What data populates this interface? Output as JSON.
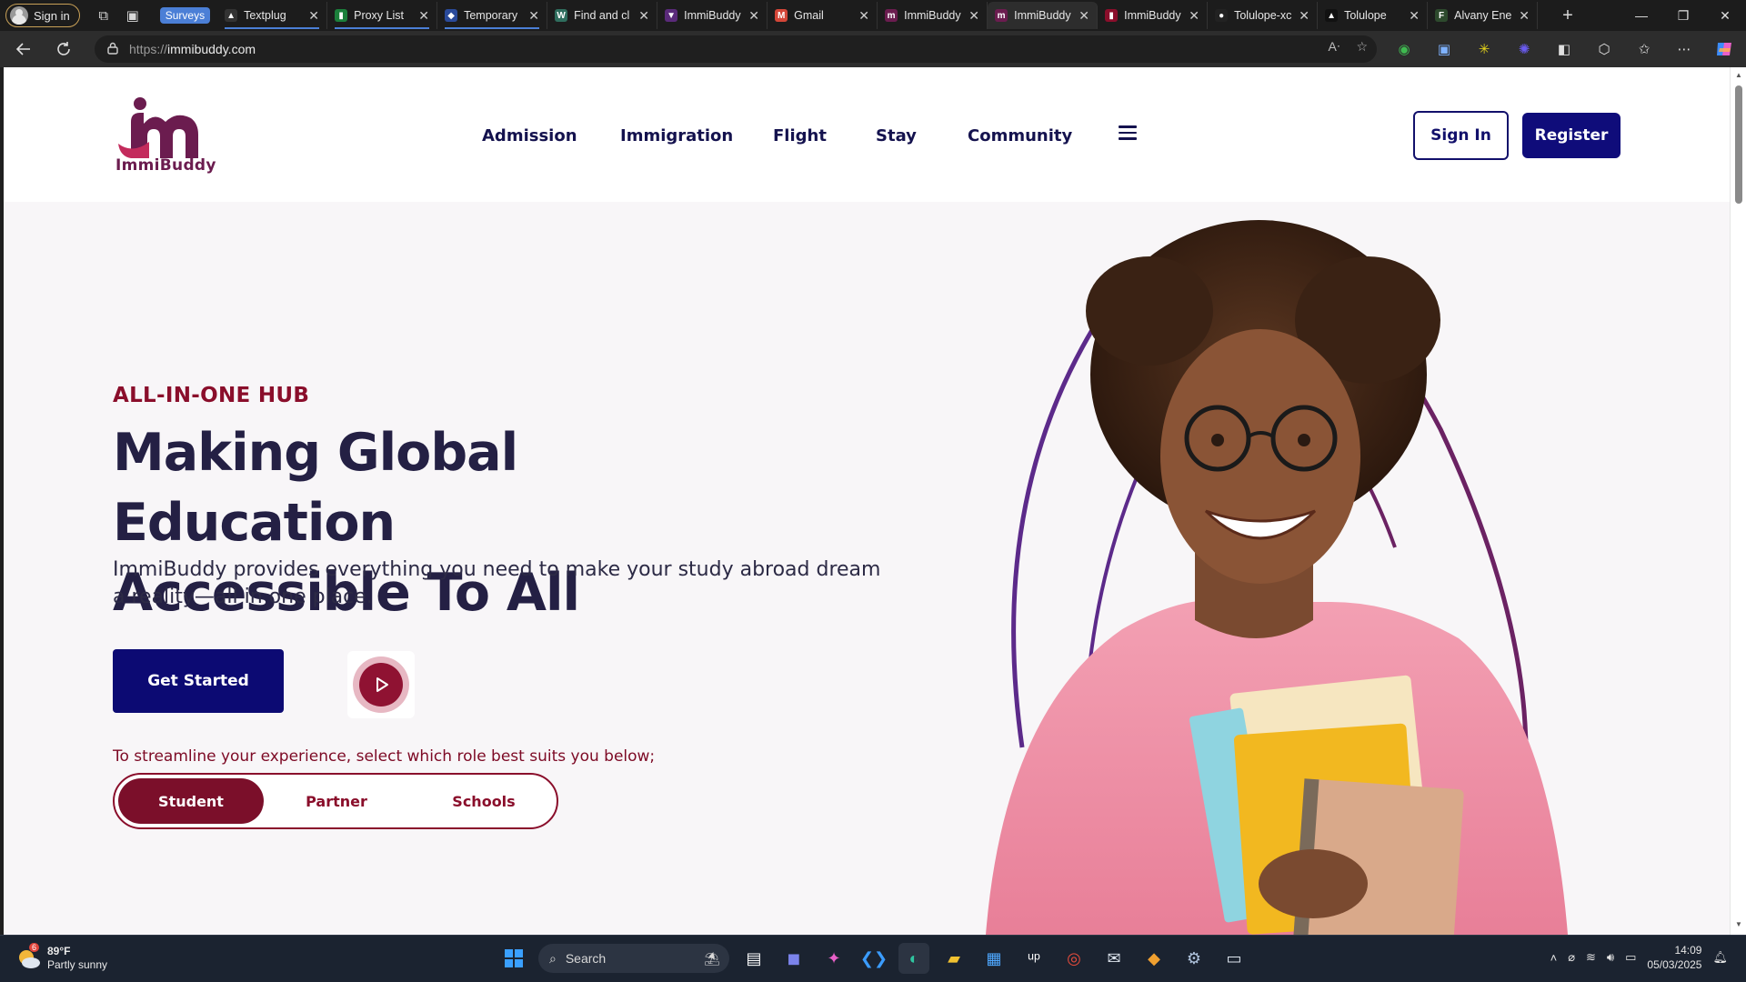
{
  "browser": {
    "profile_label": "Sign in",
    "tab_group_label": "Surveys",
    "tabs": [
      {
        "title": "Textplug",
        "favicon_color": "#333333",
        "favicon_char": "▲"
      },
      {
        "title": "Proxy List",
        "favicon_color": "#1b7f3b",
        "favicon_char": "▮"
      },
      {
        "title": "Temporary",
        "favicon_color": "#2a4a9a",
        "favicon_char": "◆"
      },
      {
        "title": "Find and cl",
        "favicon_color": "#2f6e5e",
        "favicon_char": "W"
      },
      {
        "title": "ImmiBuddy",
        "favicon_color": "#5a2a7a",
        "favicon_char": "▼"
      },
      {
        "title": "Gmail",
        "favicon_color": "#d44638",
        "favicon_char": "M"
      },
      {
        "title": "ImmiBuddy",
        "favicon_color": "#6b1c4f",
        "favicon_char": "m"
      },
      {
        "title": "ImmiBuddy",
        "favicon_color": "#6b1c4f",
        "favicon_char": "m"
      },
      {
        "title": "ImmiBuddy",
        "favicon_color": "#8a0e2b",
        "favicon_char": "▮"
      },
      {
        "title": "Tolulope-xc",
        "favicon_color": "#222222",
        "favicon_char": "●"
      },
      {
        "title": "Tolulope",
        "favicon_color": "#111111",
        "favicon_char": "▲"
      },
      {
        "title": "Alvany Ene",
        "favicon_color": "#2d4a2d",
        "favicon_char": "F"
      }
    ],
    "active_tab_index": 7,
    "url_scheme": "https://",
    "url_host": "immibuddy.com"
  },
  "site": {
    "logo_text": "ImmiBuddy",
    "nav": [
      "Admission",
      "Immigration",
      "Flight",
      "Stay",
      "Community"
    ],
    "sign_in": "Sign In",
    "register": "Register"
  },
  "hero": {
    "eyebrow": "ALL-IN-ONE HUB",
    "headline_line1": "Making Global Education",
    "headline_line2": "Accessible To All",
    "subtext": "ImmiBuddy provides everything you need to make your study abroad dream a reality—all in one place.",
    "cta": "Get Started",
    "role_hint": "To streamline your experience, select which role best suits you below;",
    "roles": [
      "Student",
      "Partner",
      "Schools"
    ],
    "active_role": "Student"
  },
  "taskbar": {
    "weather_badge": "6",
    "temperature": "89°F",
    "condition": "Partly sunny",
    "search_label": "Search",
    "time": "14:09",
    "date": "05/03/2025"
  },
  "colors": {
    "brand_navy": "#0f0c7a",
    "brand_maroon": "#8a0e2b",
    "logo_purple": "#6b1c4f",
    "tab_group_blue": "#4b7fd6"
  }
}
